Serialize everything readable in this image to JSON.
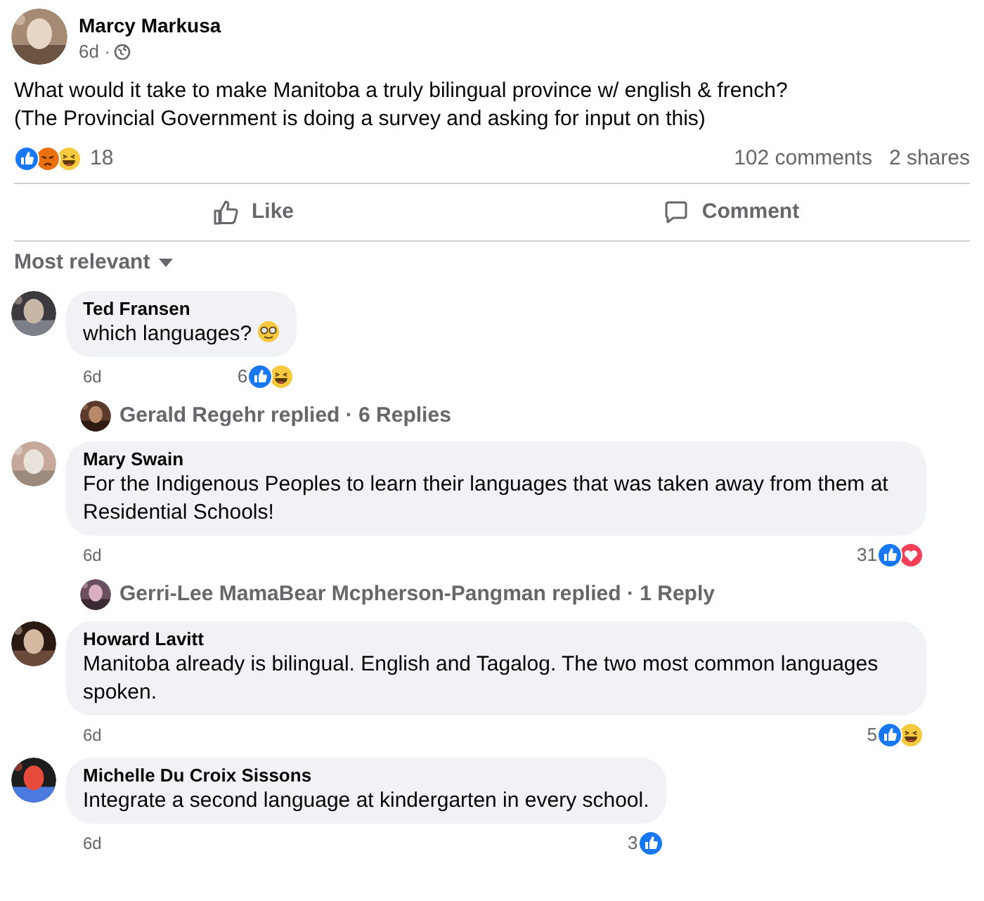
{
  "post": {
    "author": "Marcy Markusa",
    "time": "6d ·",
    "text_lines": [
      "What would it take to make Manitoba a truly bilingual province w/ english & french?",
      "(The Provincial Government is doing a survey and asking for input on this)"
    ],
    "reactions": [
      {
        "kind": "like"
      },
      {
        "kind": "angry"
      },
      {
        "kind": "haha"
      }
    ],
    "reaction_count": "18",
    "comments_count": "102 comments",
    "shares_count": "2 shares"
  },
  "actions": [
    {
      "kind": "like",
      "label": "Like"
    },
    {
      "kind": "comment",
      "label": "Comment"
    }
  ],
  "sort": {
    "label": "Most relevant"
  },
  "comments": [
    {
      "author": "Ted Fransen",
      "text": "which languages?",
      "emoji": true,
      "time": "6d",
      "reaction_count": "6",
      "reactions": [
        {
          "kind": "like"
        },
        {
          "kind": "haha"
        }
      ],
      "replies": {
        "text": "Gerald Regehr replied · 6 Replies"
      }
    },
    {
      "author": "Mary Swain",
      "text": "For the Indigenous Peoples to learn their languages that was taken away from them at Residential Schools!",
      "emoji": false,
      "time": "6d",
      "reaction_count": "31",
      "reactions": [
        {
          "kind": "like"
        },
        {
          "kind": "love"
        }
      ],
      "replies": {
        "text": "Gerri-Lee MamaBear Mcpherson-Pangman replied · 1 Reply"
      }
    },
    {
      "author": "Howard Lavitt",
      "text": "Manitoba already is bilingual. English and Tagalog. The two most common languages spoken.",
      "emoji": false,
      "time": "6d",
      "reaction_count": "5",
      "reactions": [
        {
          "kind": "like"
        },
        {
          "kind": "haha"
        }
      ]
    },
    {
      "author": "Michelle Du Croix Sissons",
      "text": "Integrate a second language at kindergarten in every school.",
      "emoji": false,
      "time": "6d",
      "reaction_count": "3",
      "reactions": [
        {
          "kind": "like"
        }
      ]
    }
  ]
}
